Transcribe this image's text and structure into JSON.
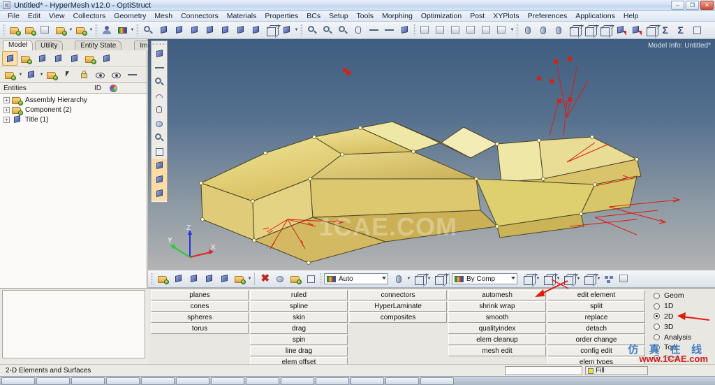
{
  "window": {
    "title": "Untitled* - HyperMesh v12.0 - OptiStruct",
    "icon": "hypermesh-icon",
    "minimize": "–",
    "restore": "❐",
    "close": "✕"
  },
  "menubar": {
    "items": [
      "File",
      "Edit",
      "View",
      "Collectors",
      "Geometry",
      "Mesh",
      "Connectors",
      "Materials",
      "Properties",
      "BCs",
      "Setup",
      "Tools",
      "Morphing",
      "Optimization",
      "Post",
      "XYPlots",
      "Preferences",
      "Applications",
      "Help"
    ]
  },
  "toolbar": {
    "groups": [
      {
        "name": "file-tools",
        "buttons": [
          {
            "icon": "open-model-icon",
            "label": "Open Model"
          },
          {
            "icon": "open-folder-icon",
            "label": "Import"
          },
          {
            "icon": "save-icon",
            "label": "Save"
          },
          {
            "icon": "import-solver-deck-icon",
            "label": "Import Solver Deck"
          },
          {
            "icon": "export-solver-deck-icon",
            "label": "Export Solver Deck"
          }
        ]
      },
      {
        "name": "user-tools",
        "buttons": [
          {
            "icon": "user-profile-icon",
            "label": "User Profiles"
          },
          {
            "icon": "color-palette-icon",
            "label": "Options"
          }
        ]
      },
      {
        "name": "view-tools",
        "buttons": [
          {
            "icon": "fit-view-icon",
            "label": "Fit View"
          },
          {
            "icon": "previous-view-icon",
            "label": "Previous View"
          },
          {
            "icon": "xy-view-icon",
            "label": "XY Top View"
          },
          {
            "icon": "yx-view-icon",
            "label": "YX View"
          },
          {
            "icon": "zx-view-icon",
            "label": "ZX View"
          },
          {
            "icon": "xz-view-icon",
            "label": "XZ View"
          },
          {
            "icon": "zy-view-icon",
            "label": "ZY View"
          },
          {
            "icon": "yz-view-icon",
            "label": "YZ View"
          },
          {
            "icon": "iso-view-icon",
            "label": "Isometric View"
          },
          {
            "icon": "rotate-view-icon",
            "label": "Rotate"
          }
        ]
      },
      {
        "name": "zoom-tools",
        "buttons": [
          {
            "icon": "zoom-in-icon",
            "label": "Zoom In"
          },
          {
            "icon": "zoom-out-icon",
            "label": "Zoom Out"
          },
          {
            "icon": "zoom-center-icon",
            "label": "Center"
          },
          {
            "icon": "pan-hand-icon",
            "label": "Pan"
          },
          {
            "icon": "arrow-horizontal-icon",
            "label": "Rotate Horizontal"
          },
          {
            "icon": "arrow-vertical-icon",
            "label": "Rotate Vertical"
          },
          {
            "icon": "circle-rotate-icon",
            "label": "Free Rotate"
          }
        ]
      },
      {
        "name": "capture-tools",
        "buttons": [
          {
            "icon": "save-image-icon",
            "label": "Save Image"
          },
          {
            "icon": "capture-window-icon",
            "label": "Capture Window"
          },
          {
            "icon": "capture-graphics-icon",
            "label": "Capture Graphics Area"
          },
          {
            "icon": "capture-region-icon",
            "label": "Capture Region"
          },
          {
            "icon": "capture-screen-icon",
            "label": "Capture Screen"
          },
          {
            "icon": "capture-video-icon",
            "label": "Capture Video"
          }
        ]
      },
      {
        "name": "entity-tools",
        "buttons": [
          {
            "icon": "node-edge-icon",
            "label": "Nodes"
          },
          {
            "icon": "line-icon",
            "label": "Lines"
          },
          {
            "icon": "cylinder-icon",
            "label": "Solids"
          },
          {
            "icon": "wire-cube-icon",
            "label": "Wireframe"
          },
          {
            "icon": "shaded-cube-icon",
            "label": "Shaded"
          },
          {
            "icon": "smooth-cube-icon",
            "label": "Smooth Shaded"
          },
          {
            "icon": "mesh-red-icon",
            "label": "Mesh Lines"
          },
          {
            "icon": "mesh-feature-icon",
            "label": "Feature Lines"
          },
          {
            "icon": "mesh-solid-icon",
            "label": "Solid Mesh"
          },
          {
            "icon": "summation-icon",
            "label": "Summary"
          },
          {
            "icon": "summation-alert-icon",
            "label": "Summary Template"
          },
          {
            "icon": "table-icon",
            "label": "Matrix Browser"
          }
        ]
      }
    ]
  },
  "left_dock": {
    "tabs": [
      {
        "label": "Model",
        "selected": true
      },
      {
        "label": "Utility",
        "selected": false
      },
      {
        "label": "Entity State",
        "selected": false
      },
      {
        "label": "Import",
        "selected": false
      }
    ],
    "close_label": "✕",
    "toolbar_row1": [
      {
        "icon": "model-browser-icon",
        "label": "Model",
        "selected": true
      },
      {
        "icon": "assembly-icon",
        "label": "Assembly Hierarchy",
        "selected": false
      },
      {
        "icon": "component-icon",
        "label": "Component",
        "selected": false
      },
      {
        "icon": "property-icon",
        "label": "Property",
        "selected": false
      },
      {
        "icon": "material-icon",
        "label": "Material",
        "selected": false
      },
      {
        "icon": "load-collector-icon",
        "label": "Load Collector",
        "selected": false
      },
      {
        "icon": "include-icon",
        "label": "Include",
        "selected": false
      }
    ],
    "toolbar_row2": [
      {
        "icon": "folder-blue-icon",
        "label": "Create Component"
      },
      {
        "icon": "diamond-icon",
        "label": "Create Property"
      },
      {
        "icon": "folder-multi-icon",
        "label": "Organize"
      },
      {
        "icon": "cursor-icon",
        "label": "Select"
      },
      {
        "icon": "lock-icon",
        "label": "Lock"
      },
      {
        "icon": "eye-plusminus-icon",
        "label": "Show/Hide"
      },
      {
        "icon": "eye-1-icon",
        "label": "Isolate"
      },
      {
        "icon": "undo-arrow-icon",
        "label": "Reverse"
      }
    ],
    "tree_header": {
      "entities": "Entities",
      "id": "ID",
      "color_icon": "color-wheel-icon"
    },
    "tree_rows": [
      {
        "expander": "+",
        "icon": "assembly-hierarchy-icon",
        "label": "Assembly Hierarchy"
      },
      {
        "expander": "+",
        "icon": "component-folder-icon",
        "label": "Component (2)"
      },
      {
        "expander": "+",
        "icon": "title-icon",
        "label": "Title (1)"
      }
    ]
  },
  "graphics": {
    "model_info": "Model Info: Untitled*",
    "watermark": "1CAE.COM",
    "axis_triad": {
      "x": "X",
      "y": "Y",
      "z": "Z"
    },
    "vertical_toolbar": [
      {
        "icon": "visualization-mask-icon",
        "label": "Mask"
      },
      {
        "icon": "mask-arrow-icon",
        "label": "Unmask Adjacent"
      },
      {
        "icon": "find-elements-icon",
        "label": "Find"
      },
      {
        "icon": "reverse-elements-icon",
        "label": "Reverse"
      },
      {
        "icon": "mask-panel-icon",
        "label": "Mask Panel"
      },
      {
        "icon": "sphere-clip-icon",
        "label": "Spherical Clipping"
      },
      {
        "icon": "binoculars-icon",
        "label": "Find Attached"
      },
      {
        "icon": "numbers-123-icon",
        "label": "Numbers"
      },
      {
        "icon": "abc-label-icon",
        "label": "Labels",
        "highlighted": true
      },
      {
        "icon": "abc-alert-icon",
        "label": "Notes",
        "highlighted": true
      },
      {
        "icon": "surface-select-icon",
        "label": "Surface Shade",
        "highlighted": true
      }
    ]
  },
  "graphics_toolbar": {
    "left_buttons": [
      {
        "icon": "assembly-green-icon",
        "label": "Assemblies"
      },
      {
        "icon": "component-blue-icon",
        "label": "Components"
      },
      {
        "icon": "property-icon",
        "label": "Properties"
      },
      {
        "icon": "material-icon",
        "label": "Materials"
      },
      {
        "icon": "load-down-icon",
        "label": "Loads"
      },
      {
        "icon": "folder-green-icon",
        "label": "Collectors"
      }
    ],
    "mid_buttons": [
      {
        "icon": "delete-red-x-icon",
        "label": "Delete"
      },
      {
        "icon": "sphere-stack-icon",
        "label": "Mask"
      },
      {
        "icon": "folder-star-icon",
        "label": "Organize"
      },
      {
        "icon": "numbers-123-icon",
        "label": "Renumber"
      }
    ],
    "color_mode": {
      "value": "Auto",
      "icon": "color-bar-icon"
    },
    "shape_buttons": [
      {
        "icon": "surface-edge-icon",
        "label": "Surface Edges"
      },
      {
        "icon": "surface-shade-icon",
        "label": "Surface Shading"
      },
      {
        "icon": "solid-cube-icon",
        "label": "Solid Display"
      }
    ],
    "by_comp": {
      "value": "By Comp",
      "icon": "cube-color-icon"
    },
    "display_buttons": [
      {
        "icon": "wireframe-cube-icon",
        "label": "Wireframe"
      },
      {
        "icon": "shaded-cube-icon",
        "label": "Shaded Elements"
      },
      {
        "icon": "flat-shade-icon",
        "label": "Shaded Geometry"
      },
      {
        "icon": "geom-shade-icon",
        "label": "Geometry Shading"
      },
      {
        "icon": "element-group-icon",
        "label": "Element Groups"
      },
      {
        "icon": "monitor-icon",
        "label": "Graphics Settings"
      }
    ]
  },
  "panel": {
    "columns": [
      {
        "name": "geometry-primitives",
        "items": [
          "planes",
          "cones",
          "spheres",
          "torus"
        ]
      },
      {
        "name": "surface-creation",
        "items": [
          "ruled",
          "spline",
          "skin",
          "drag",
          "spin",
          "line drag",
          "elem offset"
        ]
      },
      {
        "name": "connector-tools",
        "items": [
          "connectors",
          "HyperLaminate",
          "composites"
        ]
      },
      {
        "name": "mesh-tools",
        "items": [
          "automesh",
          "shrink wrap",
          "smooth",
          "qualityindex",
          "elem cleanup",
          "mesh edit"
        ]
      },
      {
        "name": "element-tools",
        "items": [
          "edit element",
          "split",
          "replace",
          "detach",
          "order change",
          "config edit",
          "elem types"
        ]
      }
    ],
    "page_radios": [
      {
        "label": "Geom",
        "selected": false,
        "dim": false
      },
      {
        "label": "1D",
        "selected": false,
        "dim": false
      },
      {
        "label": "2D",
        "selected": true,
        "dim": false
      },
      {
        "label": "3D",
        "selected": false,
        "dim": false
      },
      {
        "label": "Analysis",
        "selected": false,
        "dim": false
      },
      {
        "label": "Tool",
        "selected": false,
        "dim": false
      },
      {
        "label": "Post",
        "selected": false,
        "dim": true
      }
    ]
  },
  "statusbar": {
    "message": "2-D Elements and Surfaces",
    "input_value": "",
    "fill_label": "Fill"
  },
  "overlay_watermarks": {
    "brand_cn": "仿 真 在 线",
    "brand_url": "www.1CAE.com"
  },
  "taskbar": {
    "buttons": 13
  }
}
